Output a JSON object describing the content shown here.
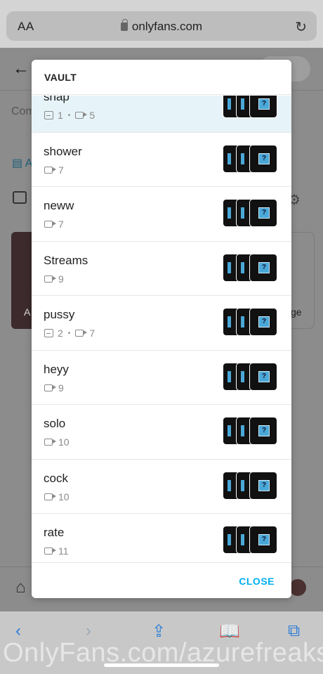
{
  "browser": {
    "text_size_label": "AA",
    "url": "onlyfans.com",
    "toolbar_icons": [
      "back-icon",
      "forward-icon",
      "share-icon",
      "bookmarks-icon",
      "tabs-icon"
    ]
  },
  "background_page": {
    "comment_placeholder": "Com",
    "calendar_label": "A",
    "thumb_label": "A",
    "card_label": "ge"
  },
  "vault": {
    "title": "VAULT",
    "close_label": "CLOSE",
    "items": [
      {
        "name": "snap",
        "photos": "1",
        "videos": "5",
        "highlighted": true
      },
      {
        "name": "shower",
        "photos": "",
        "videos": "7"
      },
      {
        "name": "neww",
        "photos": "",
        "videos": "7"
      },
      {
        "name": "Streams",
        "photos": "",
        "videos": "9"
      },
      {
        "name": "pussy",
        "photos": "2",
        "videos": "7"
      },
      {
        "name": "heyy",
        "photos": "",
        "videos": "9"
      },
      {
        "name": "solo",
        "photos": "",
        "videos": "10"
      },
      {
        "name": "cock",
        "photos": "",
        "videos": "10"
      },
      {
        "name": "rate",
        "photos": "",
        "videos": "11"
      }
    ]
  },
  "watermark": "OnlyFans.com/azurefreaks",
  "colors": {
    "accent": "#00aff0",
    "safari_blue": "#2f7fd6",
    "highlight_row": "#e6f3f8"
  }
}
